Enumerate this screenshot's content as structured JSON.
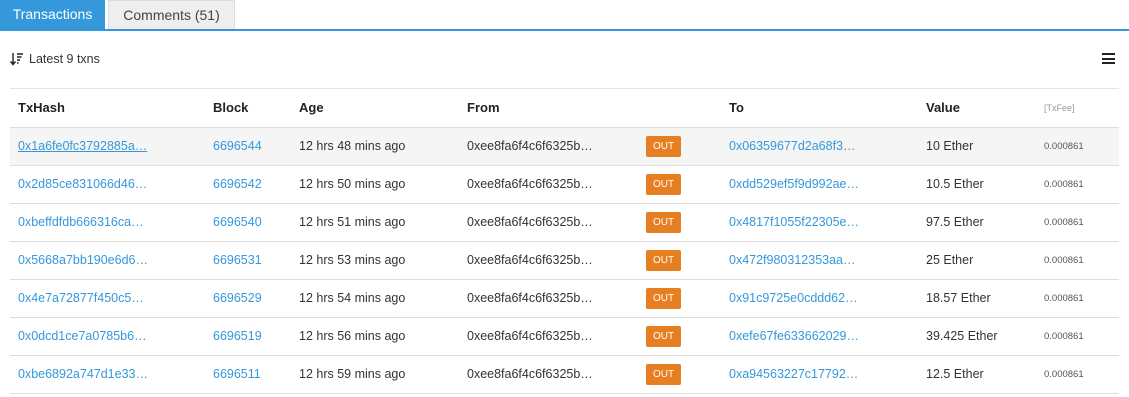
{
  "tabs": [
    {
      "label": "Transactions"
    },
    {
      "label": "Comments (51)"
    }
  ],
  "summary": {
    "text": "Latest 9 txns"
  },
  "table": {
    "headers": {
      "txhash": "TxHash",
      "block": "Block",
      "age": "Age",
      "from": "From",
      "to": "To",
      "value": "Value",
      "txfee": "[TxFee]"
    },
    "rows": [
      {
        "hash": "0x1a6fe0fc3792885a…",
        "block": "6696544",
        "age": "12 hrs 48 mins ago",
        "from": "0xee8fa6f4c6f6325b…",
        "dir": "OUT",
        "to": "0x06359677d2a68f3…",
        "value": "10 Ether",
        "fee": "0.000861"
      },
      {
        "hash": "0x2d85ce831066d46…",
        "block": "6696542",
        "age": "12 hrs 50 mins ago",
        "from": "0xee8fa6f4c6f6325b…",
        "dir": "OUT",
        "to": "0xdd529ef5f9d992ae…",
        "value": "10.5 Ether",
        "fee": "0.000861"
      },
      {
        "hash": "0xbeffdfdb666316ca…",
        "block": "6696540",
        "age": "12 hrs 51 mins ago",
        "from": "0xee8fa6f4c6f6325b…",
        "dir": "OUT",
        "to": "0x4817f1055f22305e…",
        "value": "97.5 Ether",
        "fee": "0.000861"
      },
      {
        "hash": "0x5668a7bb190e6d6…",
        "block": "6696531",
        "age": "12 hrs 53 mins ago",
        "from": "0xee8fa6f4c6f6325b…",
        "dir": "OUT",
        "to": "0x472f980312353aa…",
        "value": "25 Ether",
        "fee": "0.000861"
      },
      {
        "hash": "0x4e7a72877f450c5…",
        "block": "6696529",
        "age": "12 hrs 54 mins ago",
        "from": "0xee8fa6f4c6f6325b…",
        "dir": "OUT",
        "to": "0x91c9725e0cddd62…",
        "value": "18.57 Ether",
        "fee": "0.000861"
      },
      {
        "hash": "0x0dcd1ce7a0785b6…",
        "block": "6696519",
        "age": "12 hrs 56 mins ago",
        "from": "0xee8fa6f4c6f6325b…",
        "dir": "OUT",
        "to": "0xefe67fe633662029…",
        "value": "39.425 Ether",
        "fee": "0.000861"
      },
      {
        "hash": "0xbe6892a747d1e33…",
        "block": "6696511",
        "age": "12 hrs 59 mins ago",
        "from": "0xee8fa6f4c6f6325b…",
        "dir": "OUT",
        "to": "0xa94563227c17792…",
        "value": "12.5 Ether",
        "fee": "0.000861"
      }
    ]
  },
  "icons": {
    "sort": "sort-descending-icon",
    "menu": "hamburger-menu-icon"
  },
  "colors": {
    "accent": "#3498db",
    "out_badge": "#e67e22",
    "highlight_row": "#f5f5f5"
  }
}
